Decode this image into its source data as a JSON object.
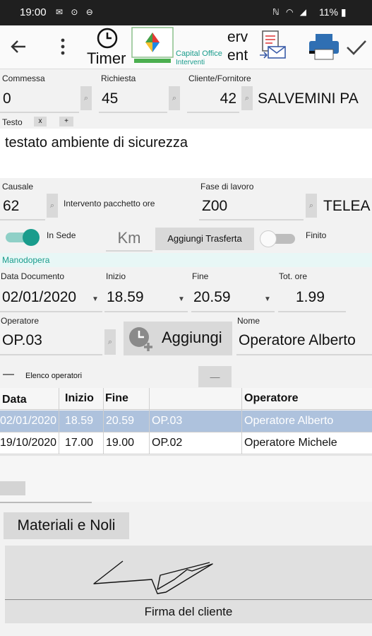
{
  "status_bar": {
    "time": "19:00",
    "left_icons": "✉ ⊙ ⊖",
    "right_icons": "ℕ ◠ ◢",
    "battery": "11% ▮"
  },
  "app_bar": {
    "timer_label": "Timer",
    "logo_line1": "Capital Office",
    "logo_line2": "Interventi",
    "truncated_title_1": "erv",
    "truncated_title_2": "ent"
  },
  "commessa": {
    "label": "Commessa",
    "value": "0"
  },
  "richiesta": {
    "label": "Richiesta",
    "value": "45"
  },
  "cliente": {
    "label": "Cliente/Fornitore",
    "code": "42",
    "name": "SALVEMINI  PA"
  },
  "testo": {
    "label": "Testo",
    "clear": "x",
    "add": "+",
    "value": "testato ambiente di sicurezza"
  },
  "causale": {
    "label": "Causale",
    "value": "62",
    "description": "Intervento pacchetto ore"
  },
  "fase": {
    "label": "Fase di lavoro",
    "value": "Z00",
    "description": "TELEA"
  },
  "in_sede": {
    "label": "In Sede",
    "checked": true
  },
  "km": {
    "placeholder": "Km"
  },
  "trasferta_button": "Aggiungi Trasferta",
  "finito": {
    "label": "Finito",
    "checked": false
  },
  "manodopera": "Manodopera",
  "data_documento": {
    "label": "Data Documento",
    "value": "02/01/2020"
  },
  "inizio": {
    "label": "Inizio",
    "value": "18.59"
  },
  "fine": {
    "label": "Fine",
    "value": "20.59"
  },
  "tot_ore": {
    "label": "Tot. ore",
    "value": "1.99"
  },
  "operatore": {
    "label": "Operatore",
    "value": "OP.03"
  },
  "aggiungi_button": "Aggiungi",
  "nome": {
    "label": "Nome",
    "value": "Operatore Alberto"
  },
  "elenco": {
    "label": "Elenco operatori",
    "collapse": "—",
    "remove": "—"
  },
  "table": {
    "columns": [
      "Data",
      "Inizio",
      "Fine",
      "",
      "Operatore"
    ],
    "rows": [
      [
        "02/01/2020",
        "18.59",
        "20.59",
        "OP.03",
        "Operatore Alberto"
      ],
      [
        "19/10/2020",
        "17.00",
        "19.00",
        "OP.02",
        "Operatore Michele"
      ]
    ]
  },
  "materiali_button": "Materiali e Noli",
  "firma_label": "Firma del cliente",
  "colors": {
    "accent": "#199c8c",
    "selected_row": "#aec2dd",
    "manodopera_bg": "#e8f7f6"
  }
}
